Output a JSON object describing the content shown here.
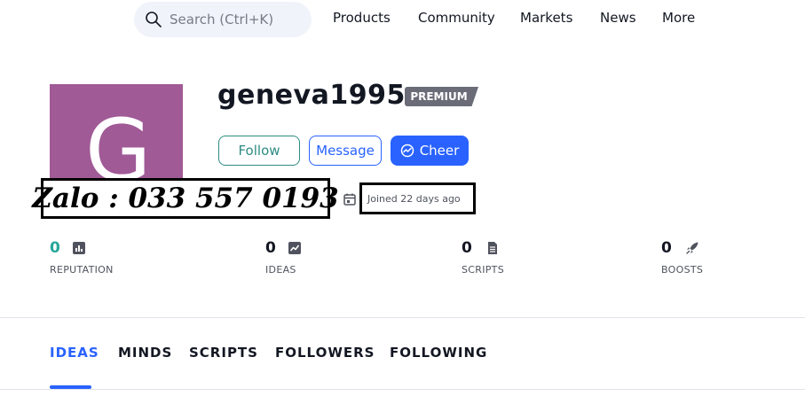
{
  "header": {
    "search_placeholder": "Search (Ctrl+K)",
    "nav": [
      "Products",
      "Community",
      "Markets",
      "News",
      "More"
    ]
  },
  "profile": {
    "avatar_letter": "G",
    "avatar_color": "#a05a96",
    "username": "geneva1995",
    "badge": "PREMIUM",
    "buttons": {
      "follow": "Follow",
      "message": "Message",
      "cheer": "Cheer"
    },
    "overlay_text": "Zalo : 033 557 0193",
    "joined": "Joined 22 days ago"
  },
  "stats": [
    {
      "value": "0",
      "label": "REPUTATION",
      "icon": "bar-chart-icon",
      "value_color": "#26a69a"
    },
    {
      "value": "0",
      "label": "IDEAS",
      "icon": "trend-chart-icon",
      "value_color": "#131722"
    },
    {
      "value": "0",
      "label": "SCRIPTS",
      "icon": "document-icon",
      "value_color": "#131722"
    },
    {
      "value": "0",
      "label": "BOOSTS",
      "icon": "rocket-icon",
      "value_color": "#131722"
    }
  ],
  "tabs": [
    "IDEAS",
    "MINDS",
    "SCRIPTS",
    "FOLLOWERS",
    "FOLLOWING"
  ],
  "active_tab": "IDEAS",
  "colors": {
    "accent": "#2962ff",
    "follow": "#2e8b83"
  }
}
